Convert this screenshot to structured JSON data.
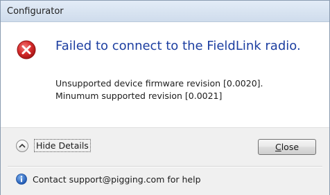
{
  "window": {
    "title": "Configurator"
  },
  "dialog": {
    "icon": "error-icon",
    "main_instruction": "Failed to connect to the FieldLink radio.",
    "message_lines": [
      "Unsupported device firmware revision [0.0020].",
      "Minumum supported revision [0.0021]"
    ]
  },
  "footer": {
    "details_toggle_label": "Hide Details",
    "details_toggle_icon": "chevron-up-icon",
    "close_button": {
      "label_accel": "C",
      "label_rest": "lose"
    },
    "info_icon": "info-icon",
    "info_text": "Contact support@pigging.com for help"
  },
  "colors": {
    "instruction": "#1c3ea0",
    "error_red": "#d42a2a",
    "info_blue": "#2a6fc9"
  }
}
